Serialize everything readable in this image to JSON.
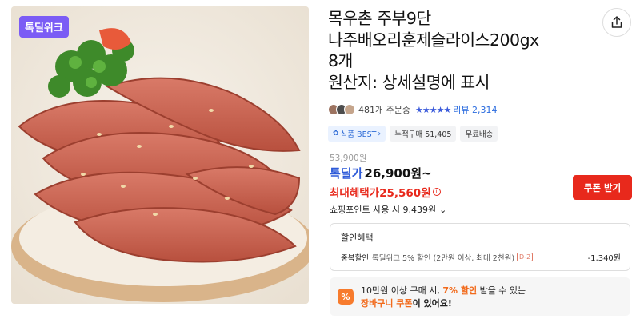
{
  "badge": {
    "label": "톡딜위크"
  },
  "product": {
    "title_lines": [
      "목우촌 주부9단",
      "나주배오리훈제슬라이스200gx",
      "8개",
      "원산지: 상세설명에 표시"
    ]
  },
  "rating": {
    "order_count": "481개 주문중",
    "stars": "★★★★★",
    "review_label": "리뷰",
    "review_count": "2,314"
  },
  "tags": [
    {
      "icon": "✿",
      "label": "식품 BEST",
      "arrow": "›"
    },
    {
      "label": "누적구매 51,405"
    },
    {
      "label": "무료배송"
    }
  ],
  "price": {
    "original": "53,900원",
    "deal_label": "톡딜가",
    "deal_price": "26,900원~",
    "max_label": "최대혜택가",
    "max_price": "25,560원",
    "info_icon": "i",
    "coupon_button": "쿠폰 받기",
    "points": "쇼핑포인트 사용 시 9,439원",
    "points_chevron": "⌄"
  },
  "discount": {
    "title": "할인혜택",
    "line_label": "중복할인",
    "line_desc": "톡딜위크 5% 할인 (2만원 이상, 최대 2천원)",
    "line_badge": "D-2",
    "line_amount": "-1,340원"
  },
  "promo": {
    "icon": "%",
    "line1_a": "10만원 이상 구매 시, ",
    "line1_b": "7% 할인",
    "line1_c": " 받을 수 있는",
    "line2_a": "장바구니 쿠폰",
    "line2_b": "이 있어요!"
  },
  "colors": {
    "badge": "#7b5cf5",
    "deal_blue": "#2e5bd8",
    "sale_red": "#e8291c",
    "promo_orange": "#f26a1b"
  }
}
